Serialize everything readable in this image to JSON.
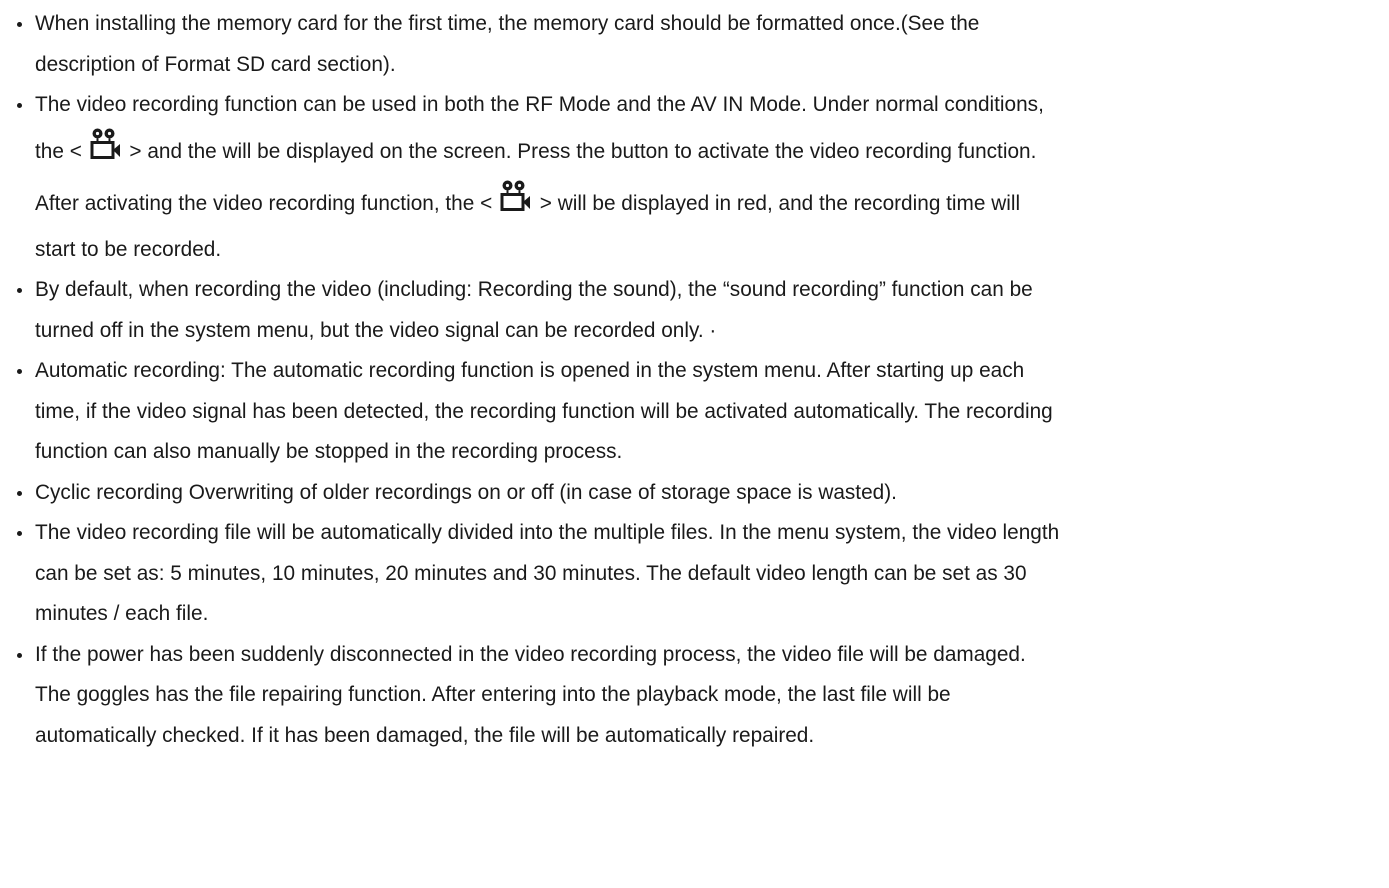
{
  "bullets": [
    {
      "lines": [
        "When installing the memory card for the first time, the memory card should be formatted once.(See the",
        "description of Format SD card section)."
      ]
    },
    {
      "lines": [
        "The video recording function can be used in both the RF Mode and the AV IN Mode. Under normal conditions,"
      ],
      "icon_line_1": {
        "before": "the <",
        "after": "> and the will be displayed on the screen. Press the button to activate the video recording function."
      },
      "icon_line_2": {
        "before": "After activating the video recording function, the <",
        "after": "> will be displayed in red, and the recording time will"
      },
      "lines_after": [
        "start to be recorded."
      ]
    },
    {
      "lines": [
        "By default, when recording the video (including: Recording the sound), the “sound recording” function can be",
        "turned off in the system menu, but the video signal can be recorded only. ·"
      ]
    },
    {
      "lines": [
        "Automatic recording: The automatic recording function is opened in the system menu. After starting up each",
        "time, if the video signal has been detected, the recording function will be activated automatically. The recording",
        "function can also manually be stopped in the recording process."
      ]
    },
    {
      "lines": [
        "Cyclic recording Overwriting of older recordings on or off (in case of storage space is wasted)."
      ]
    },
    {
      "lines": [
        "The video recording file will be automatically divided into the multiple files. In the menu system, the video length",
        "can be set as: 5 minutes, 10 minutes, 20 minutes and 30 minutes. The default video length can be set as 30",
        "minutes / each file."
      ]
    },
    {
      "lines": [
        "If the power has been suddenly disconnected in the video recording process, the video file will be damaged.",
        "The goggles has the file repairing function. After entering into the playback mode, the last file will be",
        "automatically checked. If it has been damaged, the file will be automatically repaired."
      ]
    }
  ],
  "icons": {
    "record": "video-camera-icon"
  },
  "colors": {
    "text": "#1a1a1a",
    "background": "#ffffff"
  }
}
